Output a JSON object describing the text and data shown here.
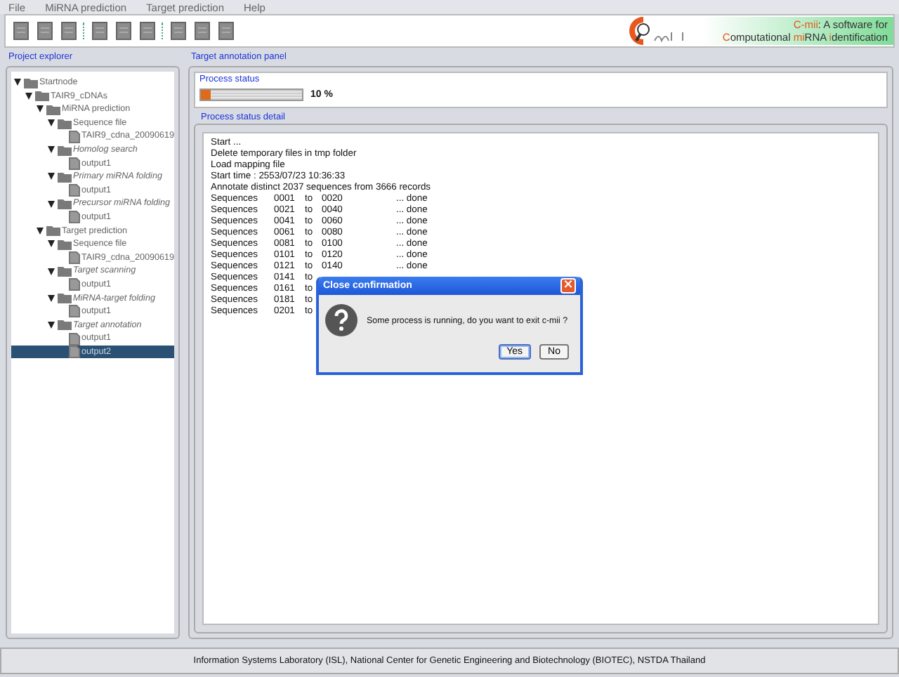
{
  "menu": [
    {
      "label": "File"
    },
    {
      "label": "MiRNA prediction"
    },
    {
      "label": "Target prediction"
    },
    {
      "label": "Help"
    }
  ],
  "banner": {
    "lines": [
      [
        {
          "text": "C-mii",
          "accent": true
        },
        {
          "text": ": A software for",
          "accent": false
        }
      ],
      [
        {
          "text": "C",
          "accent": true
        },
        {
          "text": "omputational ",
          "accent": false
        },
        {
          "text": "mi",
          "accent": true
        },
        {
          "text": "RNA ",
          "accent": false
        },
        {
          "text": "i",
          "accent": true
        },
        {
          "text": "dentification",
          "accent": false
        }
      ]
    ]
  },
  "project_explorer": {
    "title": "Project explorer",
    "tree": [
      {
        "label": "Startnode",
        "kind": "folder",
        "selected": false,
        "children": [
          {
            "label": "TAIR9_cDNAs",
            "kind": "folder",
            "selected": false,
            "children": [
              {
                "label": "MiRNA prediction",
                "kind": "folder",
                "selected": false,
                "children": [
                  {
                    "label": "Sequence file",
                    "kind": "folder",
                    "selected": false,
                    "children": [
                      {
                        "label": "TAIR9_cdna_20090619",
                        "kind": "file",
                        "selected": false
                      }
                    ]
                  },
                  {
                    "label": "Homolog search",
                    "kind": "step",
                    "selected": false,
                    "children": [
                      {
                        "label": "output1",
                        "kind": "file",
                        "selected": false
                      }
                    ]
                  },
                  {
                    "label": "Primary miRNA folding",
                    "kind": "step",
                    "selected": false,
                    "children": [
                      {
                        "label": "output1",
                        "kind": "file",
                        "selected": false
                      }
                    ]
                  },
                  {
                    "label": "Precursor miRNA folding",
                    "kind": "step",
                    "selected": false,
                    "children": [
                      {
                        "label": "output1",
                        "kind": "file",
                        "selected": false
                      }
                    ]
                  }
                ]
              },
              {
                "label": "Target prediction",
                "kind": "folder",
                "selected": false,
                "children": [
                  {
                    "label": "Sequence file",
                    "kind": "folder",
                    "selected": false,
                    "children": [
                      {
                        "label": "TAIR9_cdna_20090619",
                        "kind": "file",
                        "selected": false
                      }
                    ]
                  },
                  {
                    "label": "Target scanning",
                    "kind": "step",
                    "selected": false,
                    "children": [
                      {
                        "label": "output1",
                        "kind": "file",
                        "selected": false
                      }
                    ]
                  },
                  {
                    "label": "MiRNA-target folding",
                    "kind": "step",
                    "selected": false,
                    "children": [
                      {
                        "label": "output1",
                        "kind": "file",
                        "selected": false
                      }
                    ]
                  },
                  {
                    "label": "Target annotation",
                    "kind": "step",
                    "selected": false,
                    "children": [
                      {
                        "label": "output1",
                        "kind": "file",
                        "selected": false
                      },
                      {
                        "label": "output2",
                        "kind": "file",
                        "selected": true
                      }
                    ]
                  }
                ]
              }
            ]
          }
        ]
      }
    ]
  },
  "panel": {
    "title": "Target annotation panel",
    "process_status": {
      "title": "Process status",
      "level": 0.1,
      "reading": "10 %"
    },
    "detail": {
      "title": "Process status detail",
      "log": [
        {
          "kind": "line",
          "text": "Start ..."
        },
        {
          "kind": "line",
          "text": "Delete temporary files in tmp folder"
        },
        {
          "kind": "line",
          "text": "Load mapping file"
        },
        {
          "kind": "line",
          "text": "Start time : 2553/07/23 10:36:33"
        },
        {
          "kind": "line",
          "text": "Annotate distinct 2037 sequences from 3666 records"
        },
        {
          "kind": "seq",
          "cols": [
            "Sequences",
            "0001",
            "to",
            "0020",
            "... done"
          ]
        },
        {
          "kind": "seq",
          "cols": [
            "Sequences",
            "0021",
            "to",
            "0040",
            "... done"
          ]
        },
        {
          "kind": "seq",
          "cols": [
            "Sequences",
            "0041",
            "to",
            "0060",
            "... done"
          ]
        },
        {
          "kind": "seq",
          "cols": [
            "Sequences",
            "0061",
            "to",
            "0080",
            "... done"
          ]
        },
        {
          "kind": "seq",
          "cols": [
            "Sequences",
            "0081",
            "to",
            "0100",
            "... done"
          ]
        },
        {
          "kind": "seq",
          "cols": [
            "Sequences",
            "0101",
            "to",
            "0120",
            "... done"
          ]
        },
        {
          "kind": "seq",
          "cols": [
            "Sequences",
            "0121",
            "to",
            "0140",
            "... done"
          ]
        },
        {
          "kind": "seq",
          "cols": [
            "Sequences",
            "0141",
            "to"
          ]
        },
        {
          "kind": "seq",
          "cols": [
            "Sequences",
            "0161",
            "to"
          ]
        },
        {
          "kind": "seq",
          "cols": [
            "Sequences",
            "0181",
            "to"
          ]
        },
        {
          "kind": "seq",
          "cols": [
            "Sequences",
            "0201",
            "to"
          ]
        }
      ]
    }
  },
  "dialog": {
    "title": "Close confirmation",
    "close": "×",
    "message": "Some process is running, do you want to exit c-mii ?",
    "buttons": [
      {
        "label": "Yes",
        "selected": true
      },
      {
        "label": "No",
        "selected": false
      }
    ]
  },
  "status_bar": "Information Systems Laboratory (ISL), National Center for Genetic Engineering and Biotechnology (BIOTEC), NSTDA Thailand"
}
